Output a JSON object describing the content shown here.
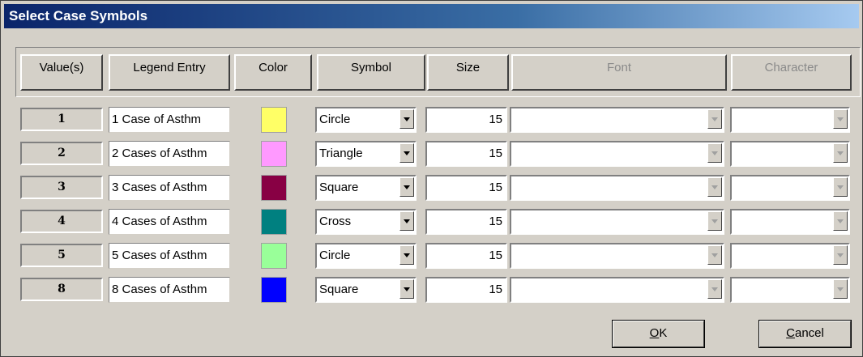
{
  "window": {
    "title": "Select Case Symbols"
  },
  "headers": {
    "values": "Value(s)",
    "legend": "Legend Entry",
    "color": "Color",
    "symbol": "Symbol",
    "size": "Size",
    "font": "Font",
    "character": "Character"
  },
  "rows": [
    {
      "value": "1",
      "legend": "1 Case of Asthm",
      "color": "#ffff66",
      "symbol": "Circle",
      "size": "15",
      "font": "",
      "character": ""
    },
    {
      "value": "2",
      "legend": "2 Cases of Asthm",
      "color": "#ff99ff",
      "symbol": "Triangle",
      "size": "15",
      "font": "",
      "character": ""
    },
    {
      "value": "3",
      "legend": "3 Cases of Asthm",
      "color": "#880044",
      "symbol": "Square",
      "size": "15",
      "font": "",
      "character": ""
    },
    {
      "value": "4",
      "legend": "4 Cases of Asthm",
      "color": "#008080",
      "symbol": "Cross",
      "size": "15",
      "font": "",
      "character": ""
    },
    {
      "value": "5",
      "legend": "5 Cases of Asthm",
      "color": "#99ff99",
      "symbol": "Circle",
      "size": "15",
      "font": "",
      "character": ""
    },
    {
      "value": "8",
      "legend": "8 Cases of Asthm",
      "color": "#0000ff",
      "symbol": "Square",
      "size": "15",
      "font": "",
      "character": ""
    }
  ],
  "buttons": {
    "ok_mnemonic": "O",
    "ok_rest": "K",
    "cancel_mnemonic": "C",
    "cancel_rest": "ancel"
  }
}
